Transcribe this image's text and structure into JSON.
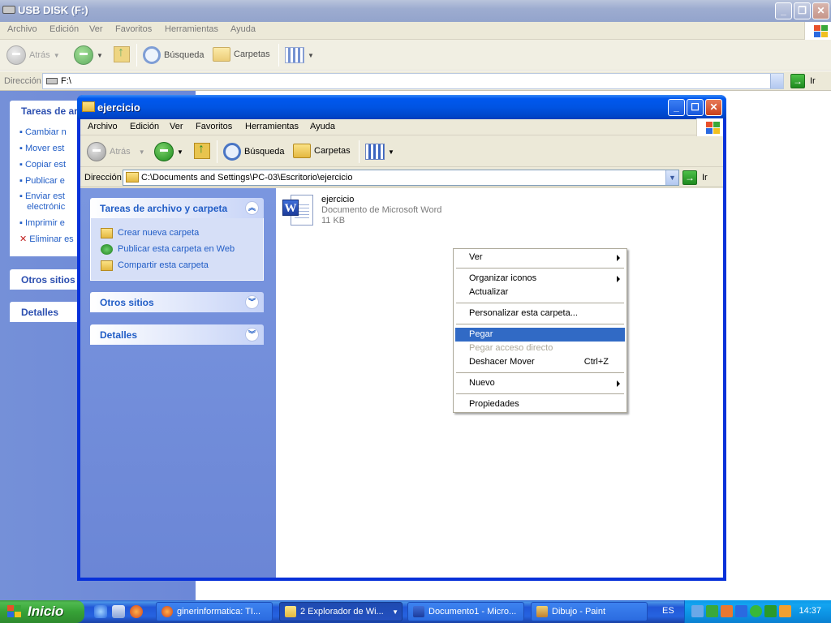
{
  "background_window": {
    "title": "USB DISK (F:)",
    "menu": [
      "Archivo",
      "Edición",
      "Ver",
      "Favoritos",
      "Herramientas",
      "Ayuda"
    ],
    "toolbar": {
      "back": "Atrás",
      "search": "Búsqueda",
      "folders": "Carpetas"
    },
    "address_label": "Dirección",
    "address_value": "F:\\",
    "go_label": "Ir",
    "tasks_header": "Tareas de ar",
    "tasks": [
      "Cambiar n",
      "Mover est",
      "Copiar est",
      "Publicar e",
      "Enviar est",
      "electrónic",
      "Imprimir e",
      "Eliminar es"
    ],
    "other_places": "Otros sitios",
    "details": "Detalles"
  },
  "window": {
    "title": "ejercicio",
    "menu": [
      "Archivo",
      "Edición",
      "Ver",
      "Favoritos",
      "Herramientas",
      "Ayuda"
    ],
    "toolbar": {
      "back": "Atrás",
      "search": "Búsqueda",
      "folders": "Carpetas"
    },
    "address_label": "Dirección",
    "address_value": "C:\\Documents and Settings\\PC-03\\Escritorio\\ejercicio",
    "go_label": "Ir",
    "tasks_panel": {
      "title": "Tareas de archivo y carpeta",
      "items": [
        "Crear nueva carpeta",
        "Publicar esta carpeta en Web",
        "Compartir esta carpeta"
      ]
    },
    "other_places": "Otros sitios",
    "details": "Detalles",
    "file": {
      "name": "ejercicio",
      "type": "Documento de Microsoft Word",
      "size": "11 KB"
    }
  },
  "context_menu": {
    "items": [
      {
        "label": "Ver",
        "submenu": true
      },
      {
        "sep": true
      },
      {
        "label": "Organizar iconos",
        "submenu": true
      },
      {
        "label": "Actualizar"
      },
      {
        "sep": true
      },
      {
        "label": "Personalizar esta carpeta..."
      },
      {
        "sep": true
      },
      {
        "label": "Pegar",
        "selected": true
      },
      {
        "label": "Pegar acceso directo",
        "disabled": true
      },
      {
        "label": "Deshacer Mover",
        "shortcut": "Ctrl+Z"
      },
      {
        "sep": true
      },
      {
        "label": "Nuevo",
        "submenu": true
      },
      {
        "sep": true
      },
      {
        "label": "Propiedades"
      }
    ]
  },
  "taskbar": {
    "start_label": "Inicio",
    "tasks": [
      "ginerinformatica: TI...",
      "2 Explorador de Wi...",
      "Documento1 - Micro...",
      "Dibujo - Paint"
    ],
    "language": "ES",
    "clock": "14:37"
  },
  "colors": {
    "xp_blue": "#0054e3",
    "menu_highlight": "#316ac5",
    "taskbar": "#2157d7",
    "start_green": "#37a237",
    "link_blue": "#215dc6"
  }
}
